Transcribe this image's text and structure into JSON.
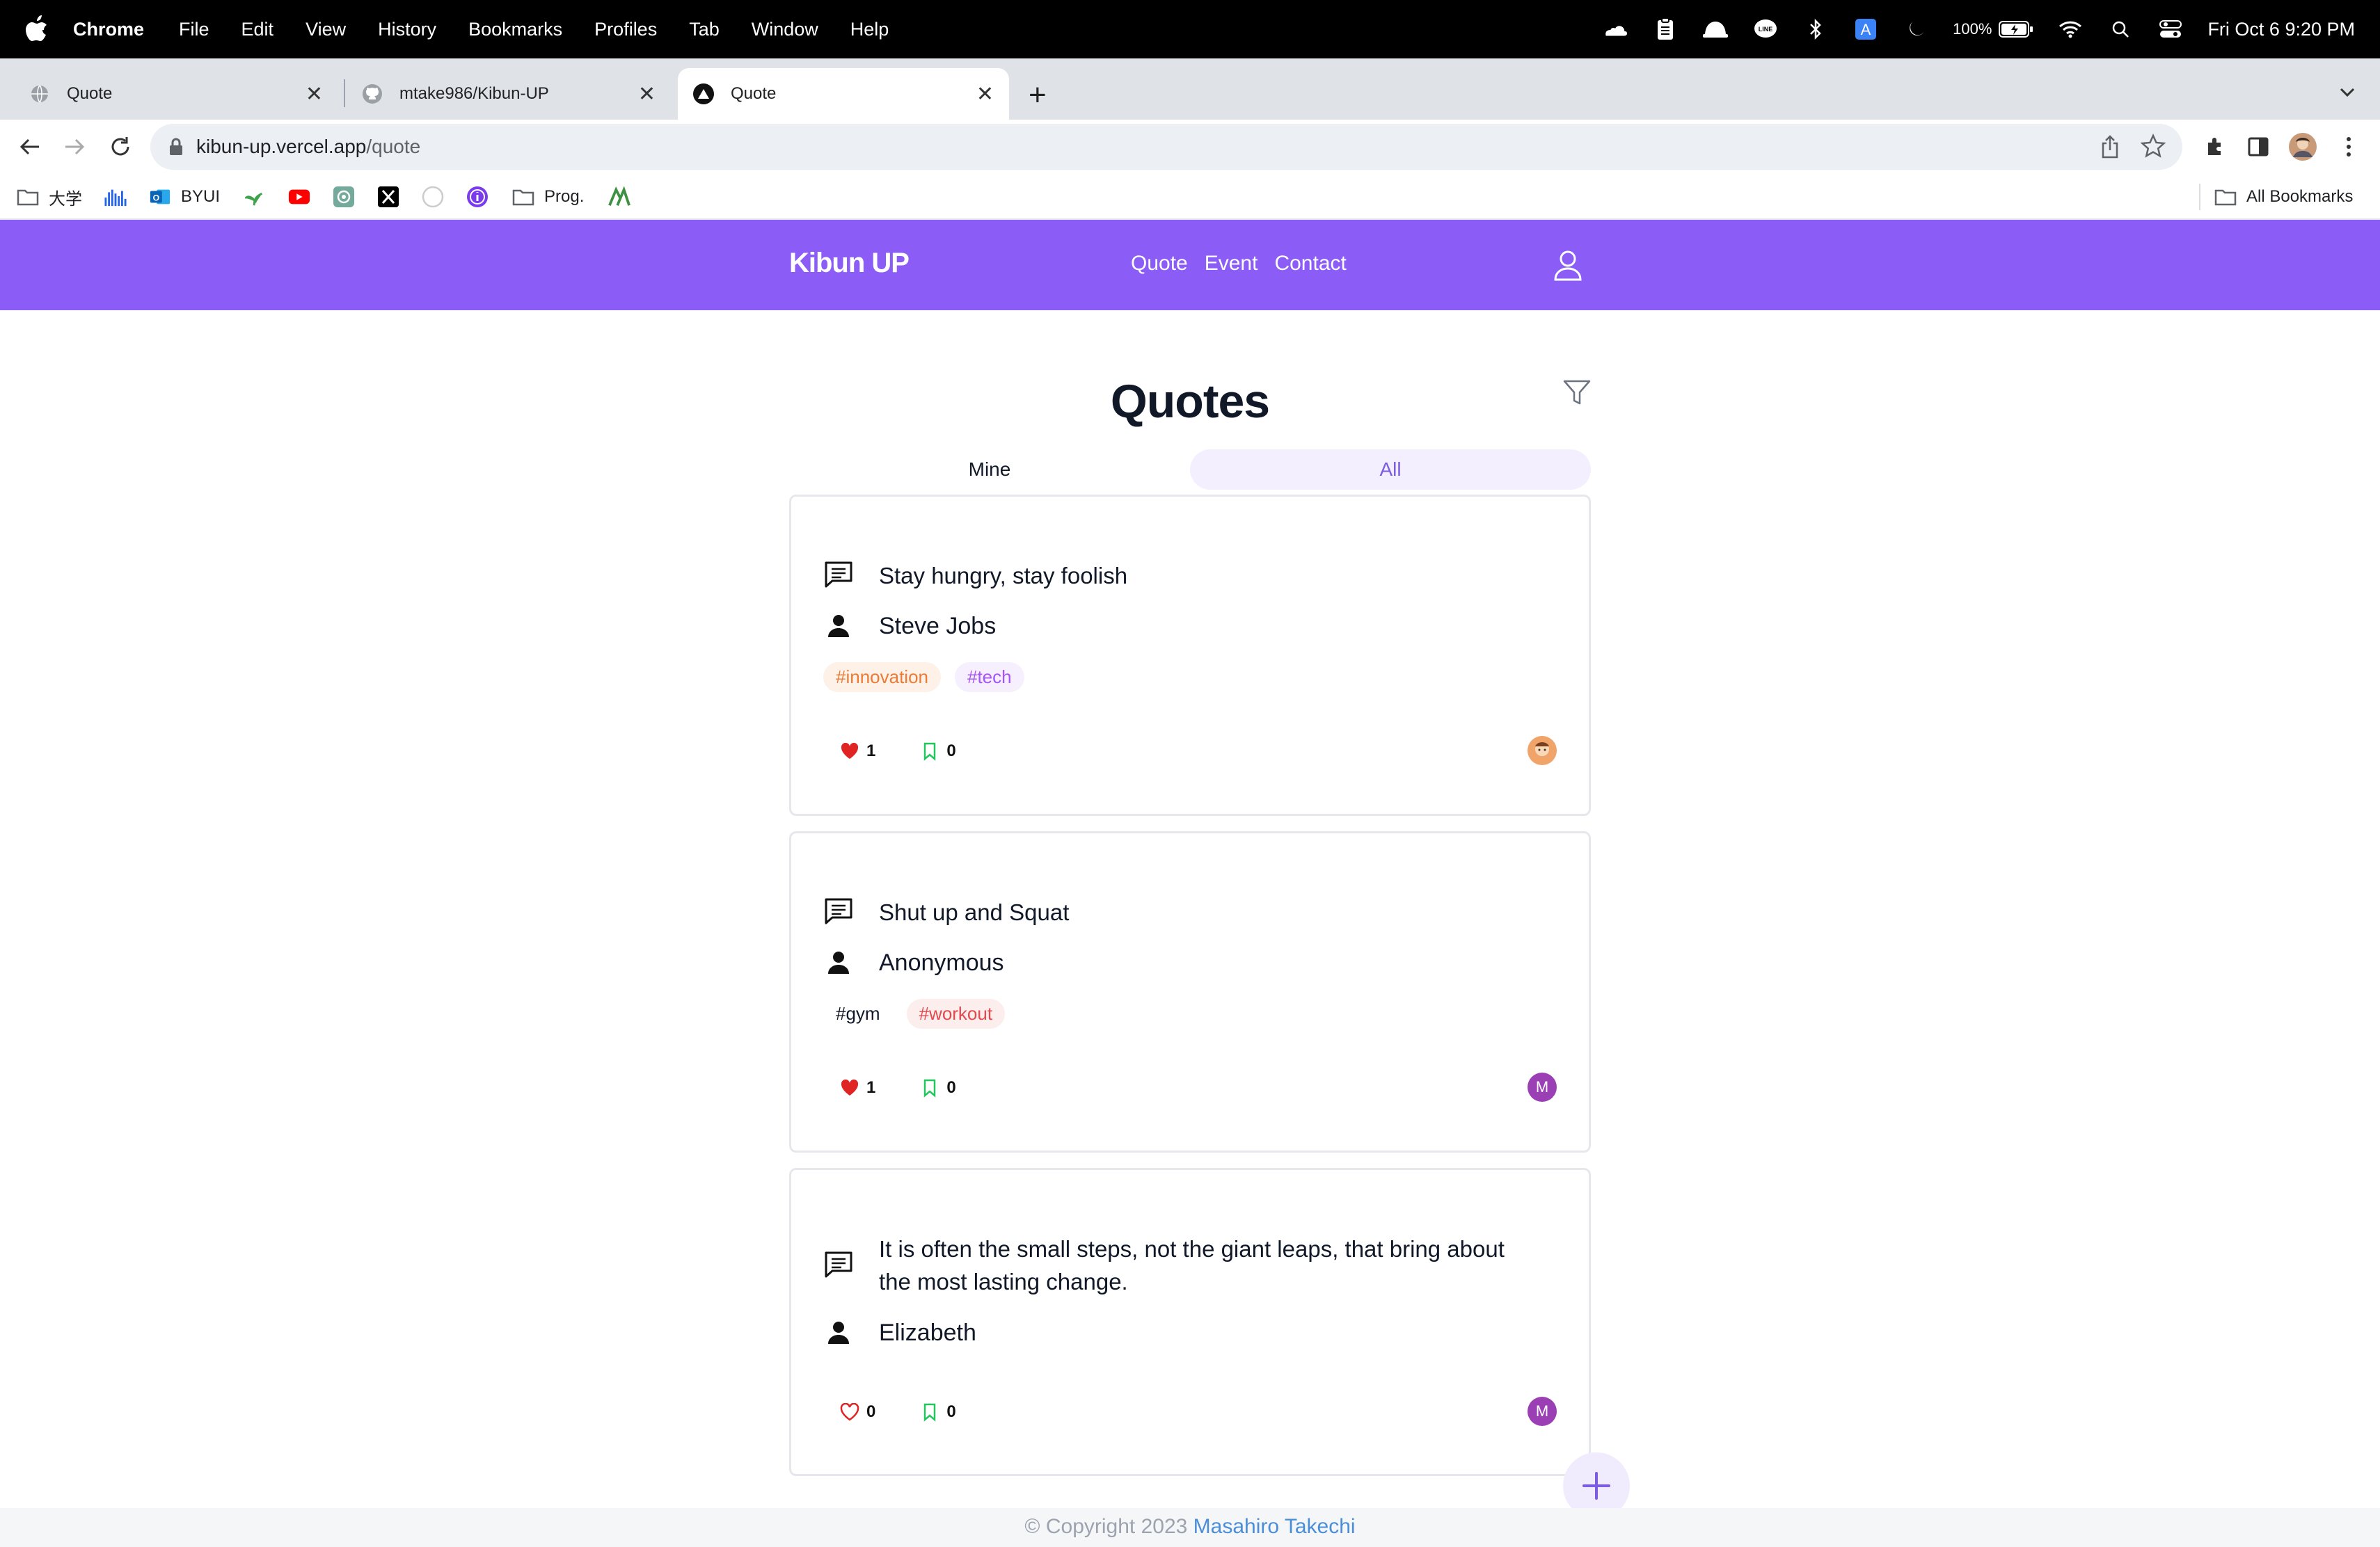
{
  "menubar": {
    "app": "Chrome",
    "items": [
      "File",
      "Edit",
      "View",
      "History",
      "Bookmarks",
      "Profiles",
      "Tab",
      "Window",
      "Help"
    ],
    "battery": "100%",
    "datetime": "Fri Oct 6  9:20 PM"
  },
  "tabs": [
    {
      "title": "Quote",
      "active": false
    },
    {
      "title": "mtake986/Kibun-UP",
      "active": false
    },
    {
      "title": "Quote",
      "active": true
    }
  ],
  "address": {
    "domain": "kibun-up.vercel.app",
    "path": "/quote"
  },
  "bookmarks": {
    "items": [
      "大学",
      "BYUI",
      "Prog."
    ],
    "all_label": "All Bookmarks"
  },
  "app": {
    "brand": "Kibun UP",
    "nav": [
      "Quote",
      "Event",
      "Contact"
    ],
    "title": "Quotes",
    "segments": {
      "mine": "Mine",
      "all": "All",
      "selected": "All"
    },
    "accent": "#8b5cf6"
  },
  "quotes": [
    {
      "text": "Stay hungry, stay foolish",
      "author": "Steve Jobs",
      "tags": [
        {
          "label": "#innovation",
          "color": "#ea7c38",
          "bg": "#fdf1e8"
        },
        {
          "label": "#tech",
          "color": "#a855f7",
          "bg": "#f6effd"
        }
      ],
      "likes": "1",
      "liked": true,
      "bookmarks": "0",
      "owner": "avatar-photo"
    },
    {
      "text": "Shut up and Squat",
      "author": "Anonymous",
      "tags": [
        {
          "label": "#gym",
          "color": "#111827",
          "bg": "#ffffff"
        },
        {
          "label": "#workout",
          "color": "#e5484d",
          "bg": "#fdeeee"
        }
      ],
      "likes": "1",
      "liked": true,
      "bookmarks": "0",
      "owner": "M"
    },
    {
      "text": "It is often the small steps, not the giant leaps, that bring about the most lasting change.",
      "author": "Elizabeth",
      "tags": [],
      "likes": "0",
      "liked": false,
      "bookmarks": "0",
      "owner": "M"
    }
  ],
  "footer": {
    "copyright": "© Copyright 2023 ",
    "author": "Masahiro Takechi"
  }
}
